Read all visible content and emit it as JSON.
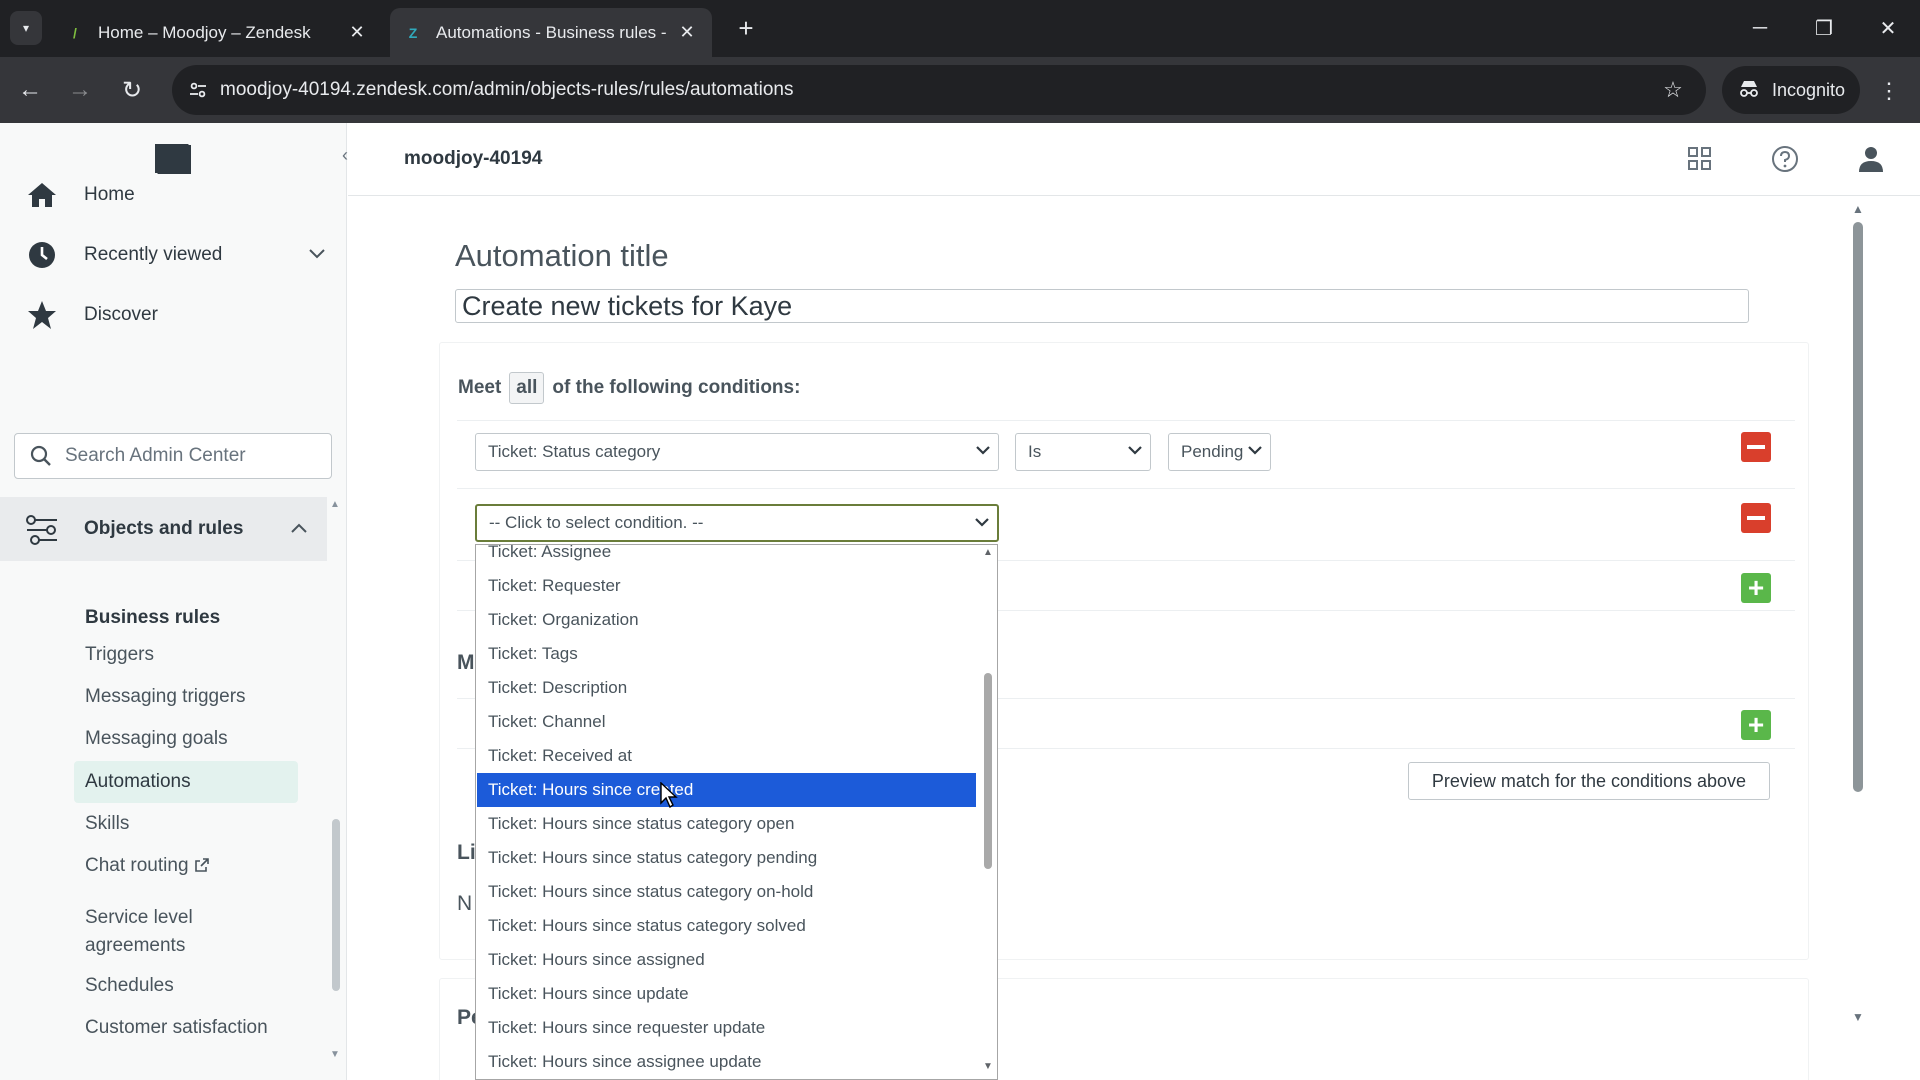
{
  "browser": {
    "tabs": [
      {
        "title": "Home – Moodjoy – Zendesk",
        "active": false
      },
      {
        "title": "Automations - Business rules -",
        "active": true
      }
    ],
    "url": "moodjoy-40194.zendesk.com/admin/objects-rules/rules/automations",
    "incognito_label": "Incognito"
  },
  "sidebar": {
    "nav": [
      {
        "label": "Home",
        "icon": "home-icon"
      },
      {
        "label": "Recently viewed",
        "icon": "clock-icon"
      },
      {
        "label": "Discover",
        "icon": "star-icon"
      }
    ],
    "search_placeholder": "Search Admin Center",
    "section": {
      "label": "Objects and rules",
      "icon": "objects-rules-icon"
    },
    "sub_heading": "Business rules",
    "sub_items": [
      {
        "label": "Triggers",
        "active": false
      },
      {
        "label": "Messaging triggers",
        "active": false
      },
      {
        "label": "Messaging goals",
        "active": false
      },
      {
        "label": "Automations",
        "active": true
      },
      {
        "label": "Skills",
        "active": false
      },
      {
        "label": "Chat routing",
        "active": false,
        "external": true
      },
      {
        "label": "Service level agreements",
        "active": false
      },
      {
        "label": "Schedules",
        "active": false
      },
      {
        "label": "Customer satisfaction",
        "active": false
      }
    ]
  },
  "header": {
    "account": "moodjoy-40194"
  },
  "form": {
    "title_label": "Automation title",
    "title_value": "Create new tickets for Kaye",
    "meet_prefix": "Meet",
    "meet_mode": "all",
    "meet_suffix": "of the following conditions:",
    "condition1": {
      "field": "Ticket: Status category",
      "operator": "Is",
      "value": "Pending"
    },
    "condition2_placeholder": "-- Click to select condition. --",
    "preview_button": "Preview match for the conditions above",
    "hidden_fragments": [
      "M",
      "Li",
      "N",
      "Pe"
    ]
  },
  "dropdown": {
    "selected_index": 7,
    "options": [
      "Ticket: Assignee",
      "Ticket: Requester",
      "Ticket: Organization",
      "Ticket: Tags",
      "Ticket: Description",
      "Ticket: Channel",
      "Ticket: Received at",
      "Ticket: Hours since created",
      "Ticket: Hours since status category open",
      "Ticket: Hours since status category pending",
      "Ticket: Hours since status category on-hold",
      "Ticket: Hours since status category solved",
      "Ticket: Hours since assigned",
      "Ticket: Hours since update",
      "Ticket: Hours since requester update",
      "Ticket: Hours since assignee update"
    ]
  },
  "colors": {
    "selection": "#1c5bd9",
    "remove": "#d93f2c",
    "add": "#5ab74a",
    "active_nav": "#e3f2ee"
  }
}
